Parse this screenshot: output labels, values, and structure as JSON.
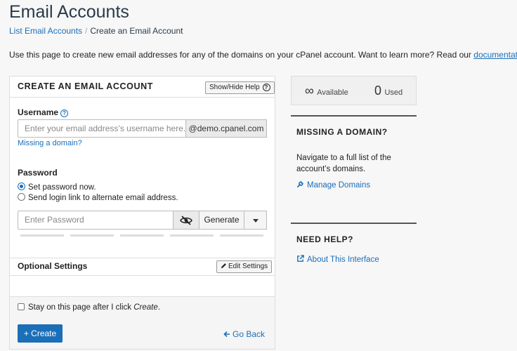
{
  "page": {
    "title": "Email Accounts",
    "breadcrumb": {
      "parent": "List Email Accounts",
      "current": "Create an Email Account"
    },
    "intro": "Use this page to create new email addresses for any of the domains on your cPanel account. Want to learn more? Read our",
    "doc_link": "documentation",
    "intro_end": "."
  },
  "form": {
    "title": "CREATE AN EMAIL ACCOUNT",
    "help_button": "Show/Hide Help",
    "username_label": "Username",
    "username_placeholder": "Enter your email address’s username here.",
    "domain": "@demo.cpanel.com",
    "missing_domain_link": "Missing a domain?",
    "password_label": "Password",
    "radio_set_now": "Set password now.",
    "radio_send_link": "Send login link to alternate email address.",
    "password_placeholder": "Enter Password",
    "generate_button": "Generate",
    "optional_title": "Optional Settings",
    "edit_settings_button": "Edit Settings",
    "stay_text_prefix": "Stay on this page after I click ",
    "stay_text_em": "Create",
    "stay_text_suffix": ".",
    "create_button": "+ Create",
    "go_back_link": "Go Back"
  },
  "stats": {
    "available_value": "∞",
    "available_label": "Available",
    "used_value": "0",
    "used_label": "Used"
  },
  "sidebar": {
    "missing_title": "MISSING A DOMAIN?",
    "missing_text": "Navigate to a full list of the account’s domains.",
    "manage_link": "Manage Domains",
    "help_title": "NEED HELP?",
    "about_link": "About This Interface"
  },
  "colors": {
    "accent": "#1b6fb8",
    "text": "#293a4a",
    "background": "#f7f7f7"
  },
  "icons": [
    "question-icon",
    "external-link-icon",
    "eye-slash-icon",
    "caret-down-icon",
    "pencil-icon",
    "arrow-left-icon",
    "wrench-icon",
    "infinity-icon"
  ]
}
